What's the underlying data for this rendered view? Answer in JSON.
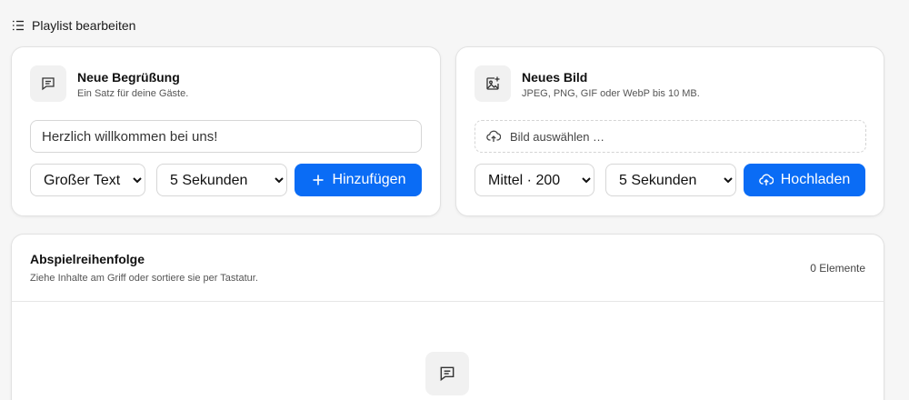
{
  "header": {
    "title": "Playlist bearbeiten",
    "icon": "list-ordered-icon"
  },
  "greeting_card": {
    "title": "Neue Begrüßung",
    "subtitle": "Ein Satz für deine Gäste.",
    "icon": "message-square-icon",
    "input_value": "Herzlich willkommen bei uns!",
    "size_select": "Großer Text",
    "duration_select": "5 Sekunden",
    "add_button": "Hinzufügen"
  },
  "image_card": {
    "title": "Neues Bild",
    "subtitle": "JPEG, PNG, GIF oder WebP bis 10 MB.",
    "icon": "image-plus-icon",
    "file_placeholder": "Bild auswählen …",
    "size_select": "Mittel · 200",
    "duration_select": "5 Sekunden",
    "upload_button": "Hochladen"
  },
  "playlist": {
    "title": "Abspielreihenfolge",
    "subtitle": "Ziehe Inhalte am Griff oder sortiere sie per Tastatur.",
    "count": "0 Elemente",
    "empty_icon": "message-square-icon"
  },
  "colors": {
    "accent": "#0a6cf5",
    "background": "#f6f6f6"
  }
}
